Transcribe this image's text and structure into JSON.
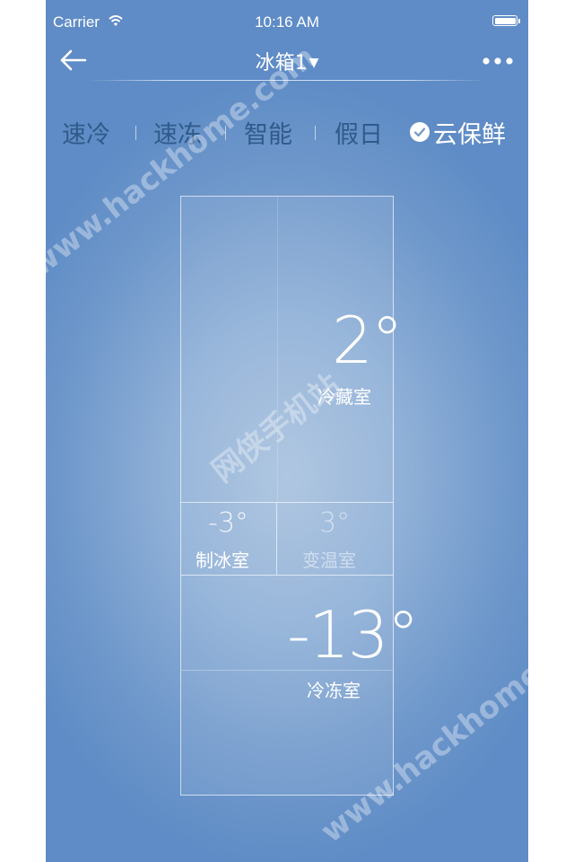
{
  "status_bar": {
    "carrier": "Carrier",
    "time": "10:16 AM"
  },
  "nav": {
    "title": "冰箱1",
    "title_caret": "▼",
    "back_icon": "arrow-left-icon",
    "more_icon": "ellipsis-icon"
  },
  "modes": [
    {
      "label": "速冷",
      "selected": false
    },
    {
      "label": "速冻",
      "selected": false
    },
    {
      "label": "智能",
      "selected": false
    },
    {
      "label": "假日",
      "selected": false
    },
    {
      "label": "云保鲜",
      "selected": true
    }
  ],
  "compartments": {
    "fridge": {
      "temp": "2°",
      "label": "冷藏室"
    },
    "ice": {
      "temp": "-3°",
      "label": "制冰室"
    },
    "variable": {
      "temp": "3°",
      "label": "变温室"
    },
    "freezer": {
      "temp": "-13°",
      "label": "冷冻室"
    }
  },
  "watermarks": {
    "url": "www.hackhome.com",
    "cn": "网侠手机站"
  },
  "colors": {
    "background": "#7aa1cf",
    "mode_text": "#2f5a8a",
    "text": "#ffffff"
  }
}
